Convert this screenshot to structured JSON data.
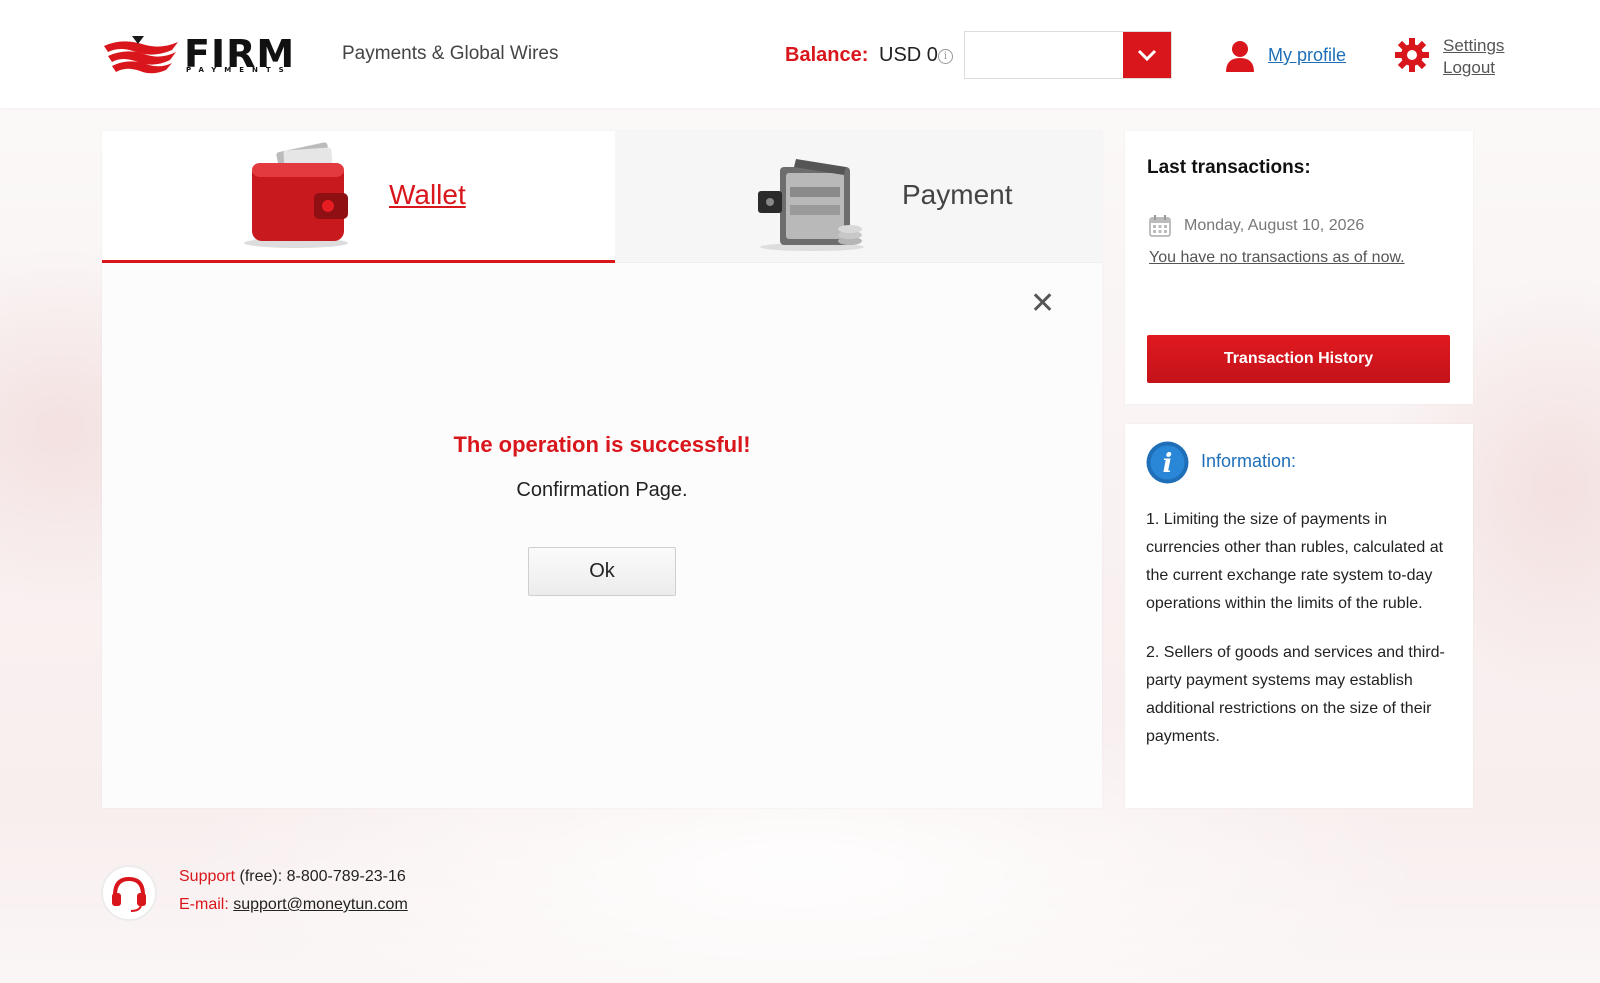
{
  "header": {
    "logo_text": "FIRM",
    "logo_subtext": "PAYMENTS",
    "tagline": "Payments & Global Wires",
    "balance_label": "Balance:",
    "balance_value": "USD 0",
    "profile_link": "My profile",
    "settings_link": "Settings",
    "logout_link": "Logout"
  },
  "tabs": [
    {
      "label": "Wallet",
      "active": true
    },
    {
      "label": "Payment",
      "active": false
    }
  ],
  "dialog": {
    "title": "The operation is successful!",
    "message": "Confirmation Page.",
    "ok_label": "Ok"
  },
  "transactions": {
    "title": "Last transactions:",
    "date": "Monday, August 10, 2026",
    "empty_text": "You have no transactions as of now.",
    "history_button": "Transaction History"
  },
  "information": {
    "title": "Information:",
    "paragraphs": [
      "1. Limiting the size of payments in currencies other than rubles, calculated at the current exchange rate system to-day operations within the limits of the ruble.",
      "2. Sellers of goods and services and third-party payment systems may establish additional restrictions on the size of their payments."
    ]
  },
  "footer": {
    "support_label": "Support",
    "support_rest": " (free): 8-800-789-23-16",
    "email_label": "E-mail: ",
    "email": "support@moneytun.com"
  },
  "colors": {
    "accent": "#d8161c",
    "link": "#1e6fb8"
  }
}
